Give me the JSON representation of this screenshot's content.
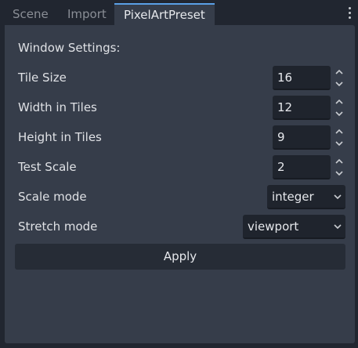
{
  "tabs": [
    {
      "label": "Scene",
      "active": false
    },
    {
      "label": "Import",
      "active": false
    },
    {
      "label": "PixelArtPreset",
      "active": true
    }
  ],
  "section_title": "Window Settings:",
  "fields": {
    "tile_size": {
      "label": "Tile Size",
      "value": "16"
    },
    "width_tiles": {
      "label": "Width in Tiles",
      "value": "12"
    },
    "height_tiles": {
      "label": "Height in Tiles",
      "value": "9"
    },
    "test_scale": {
      "label": "Test Scale",
      "value": "2"
    },
    "scale_mode": {
      "label": "Scale mode",
      "value": "integer"
    },
    "stretch_mode": {
      "label": "Stretch mode",
      "value": "viewport"
    }
  },
  "apply_label": "Apply",
  "colors": {
    "background": "#212630",
    "panel": "#363d4a",
    "field": "#1f242d",
    "accent": "#5aa0e6",
    "text": "#dfe1e5"
  },
  "icons": {
    "menu": "vertical-dots-icon",
    "spin": "up-down-arrows-icon",
    "dropdown": "chevron-down-icon"
  }
}
